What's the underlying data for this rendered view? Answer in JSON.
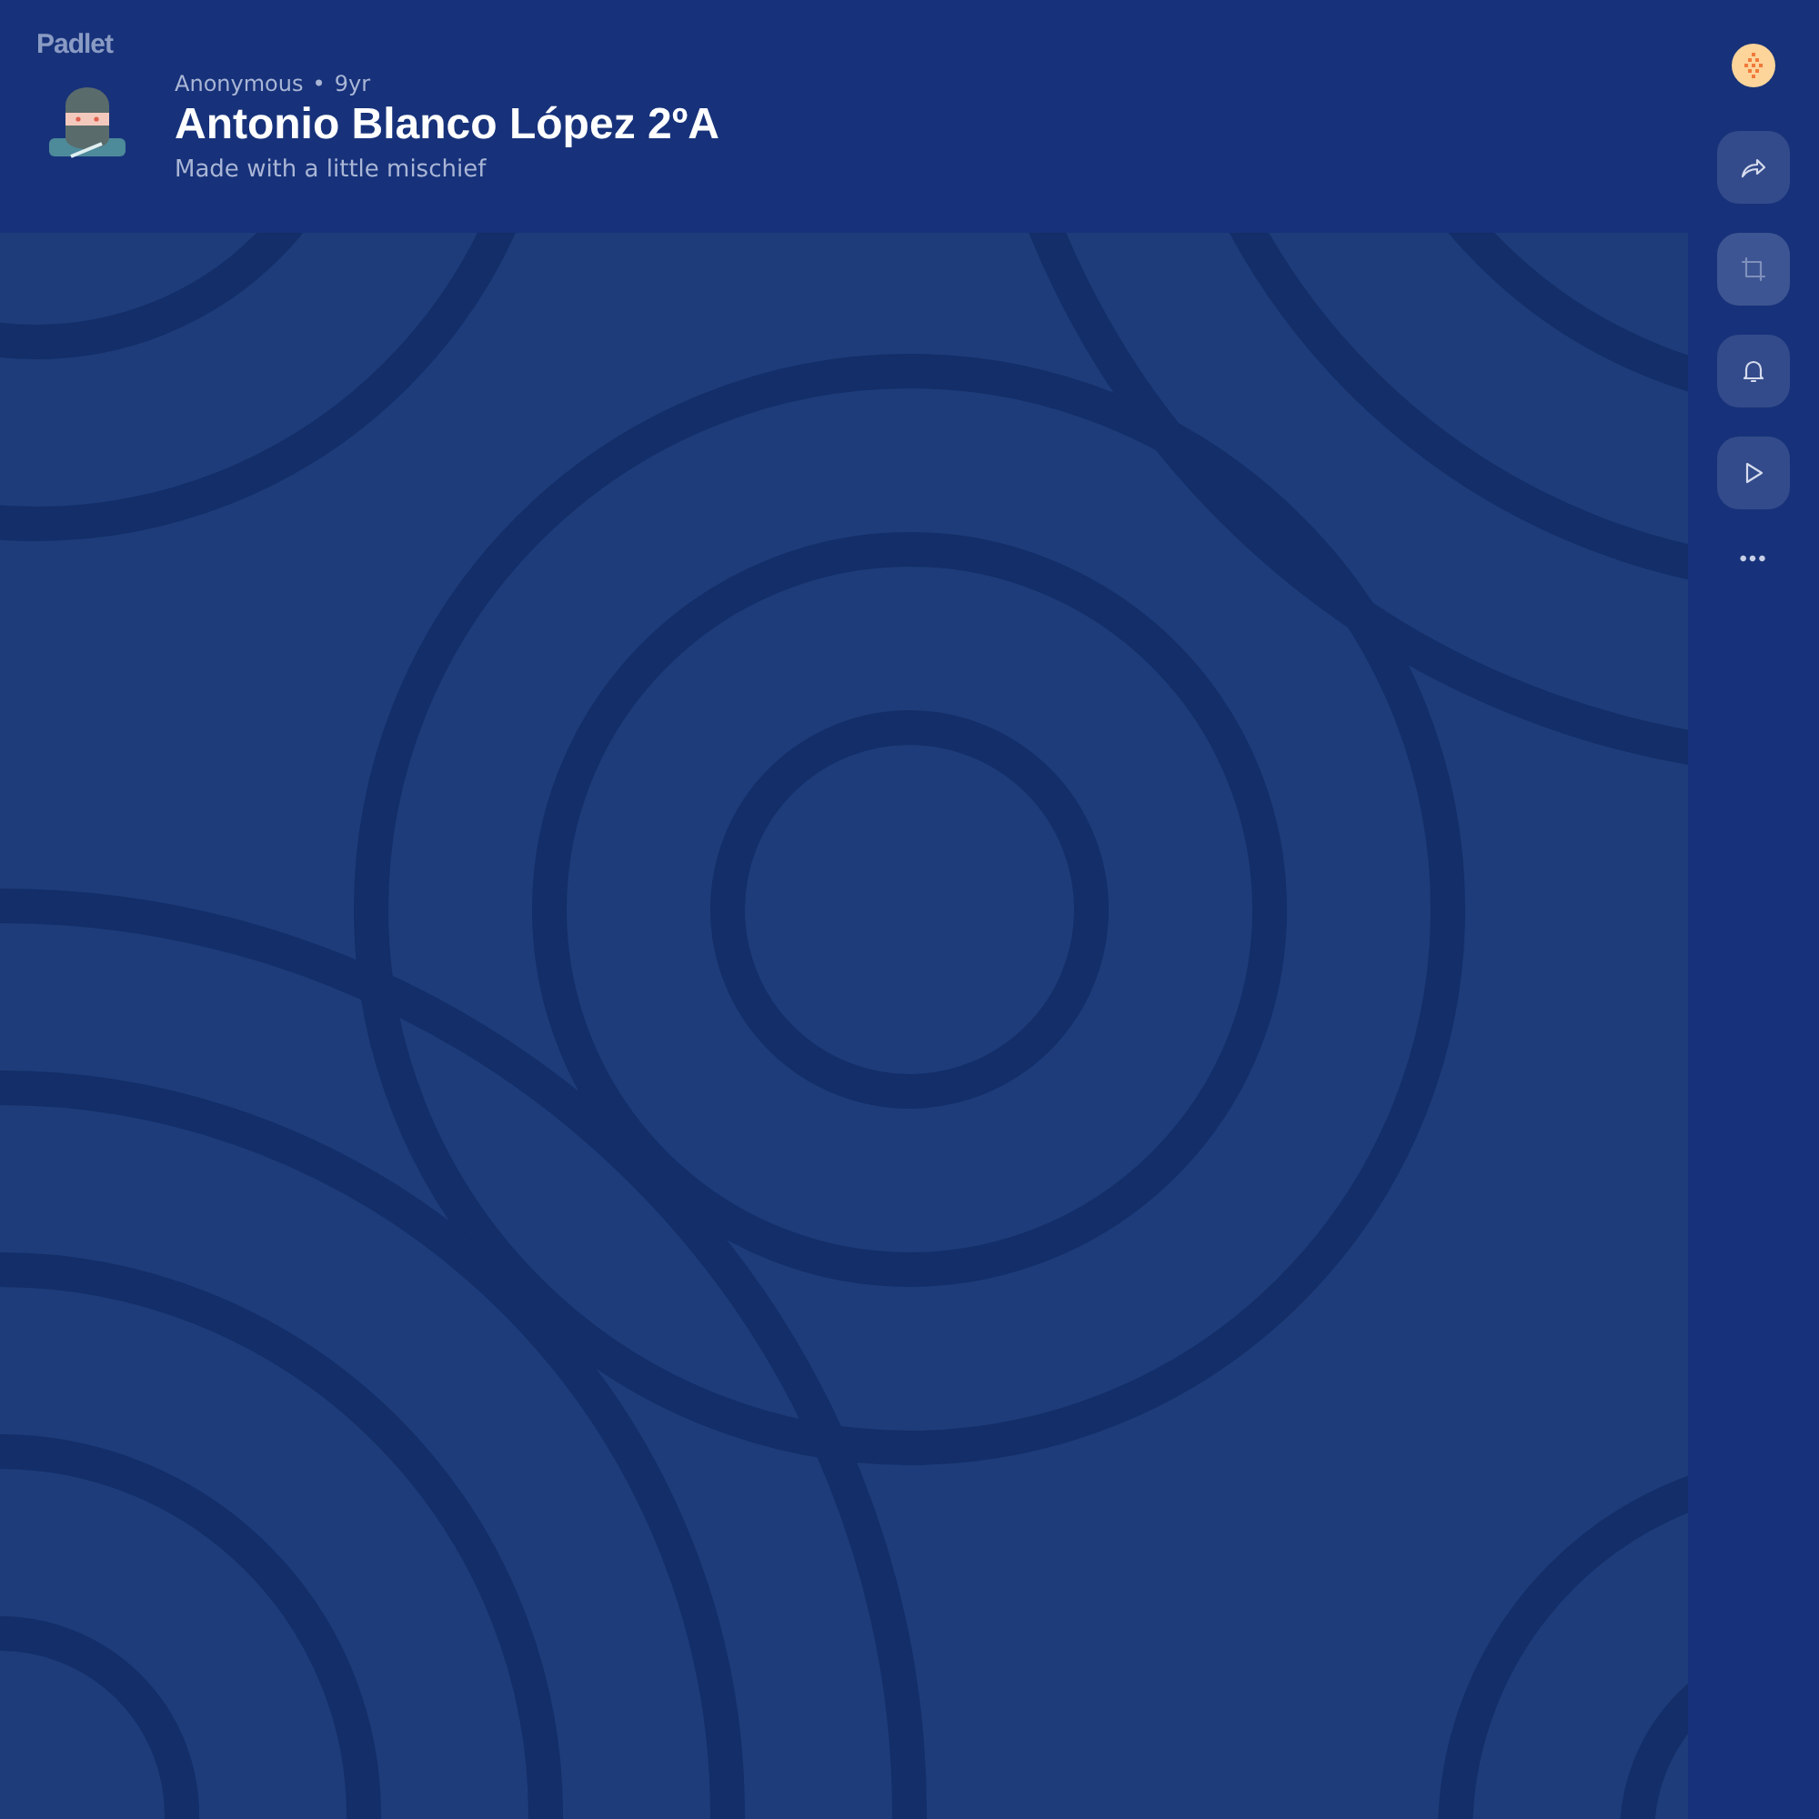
{
  "brand": "Padlet",
  "header": {
    "author": "Anonymous",
    "separator": "•",
    "age": "9yr",
    "title": "Antonio Blanco López 2ºA",
    "subtitle": "Made with a little mischief"
  },
  "actions": [
    {
      "kind": "share",
      "disabled": false
    },
    {
      "kind": "remake",
      "disabled": true
    },
    {
      "kind": "notify",
      "disabled": false
    },
    {
      "kind": "slideshow",
      "disabled": false
    }
  ],
  "more": "•••"
}
